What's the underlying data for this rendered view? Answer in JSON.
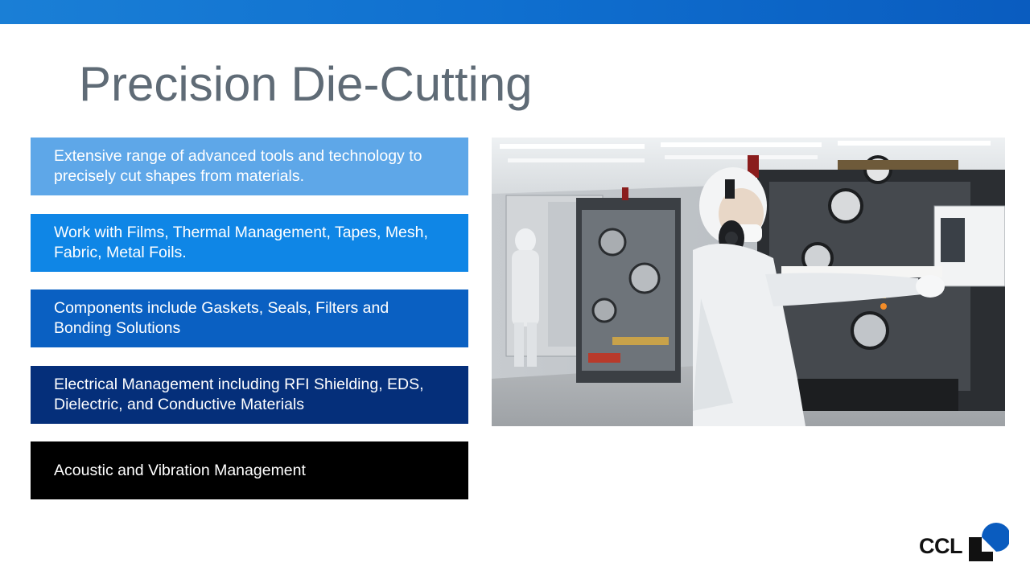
{
  "title": "Precision Die-Cutting",
  "features": [
    {
      "text": "Extensive range of advanced tools and technology to precisely cut shapes from materials.",
      "color": "#5ea7e8"
    },
    {
      "text": "Work with Films, Thermal Management, Tapes, Mesh, Fabric, Metal Foils.",
      "color": "#0f86e6"
    },
    {
      "text": "Components include Gaskets, Seals, Filters and Bonding Solutions",
      "color": "#0a60c2"
    },
    {
      "text": "Electrical Management including RFI Shielding, EDS, Dielectric, and Conductive Materials",
      "color": "#052f7a"
    },
    {
      "text": "Acoustic and Vibration Management",
      "color": "#000000"
    }
  ],
  "photo": {
    "subject": "cleanroom-die-cutting-machines"
  },
  "logo": {
    "text": "CCL",
    "accent_color": "#0a5cbf"
  },
  "colors": {
    "top_bar": "#0f6fcf",
    "title": "#5f6b76"
  }
}
